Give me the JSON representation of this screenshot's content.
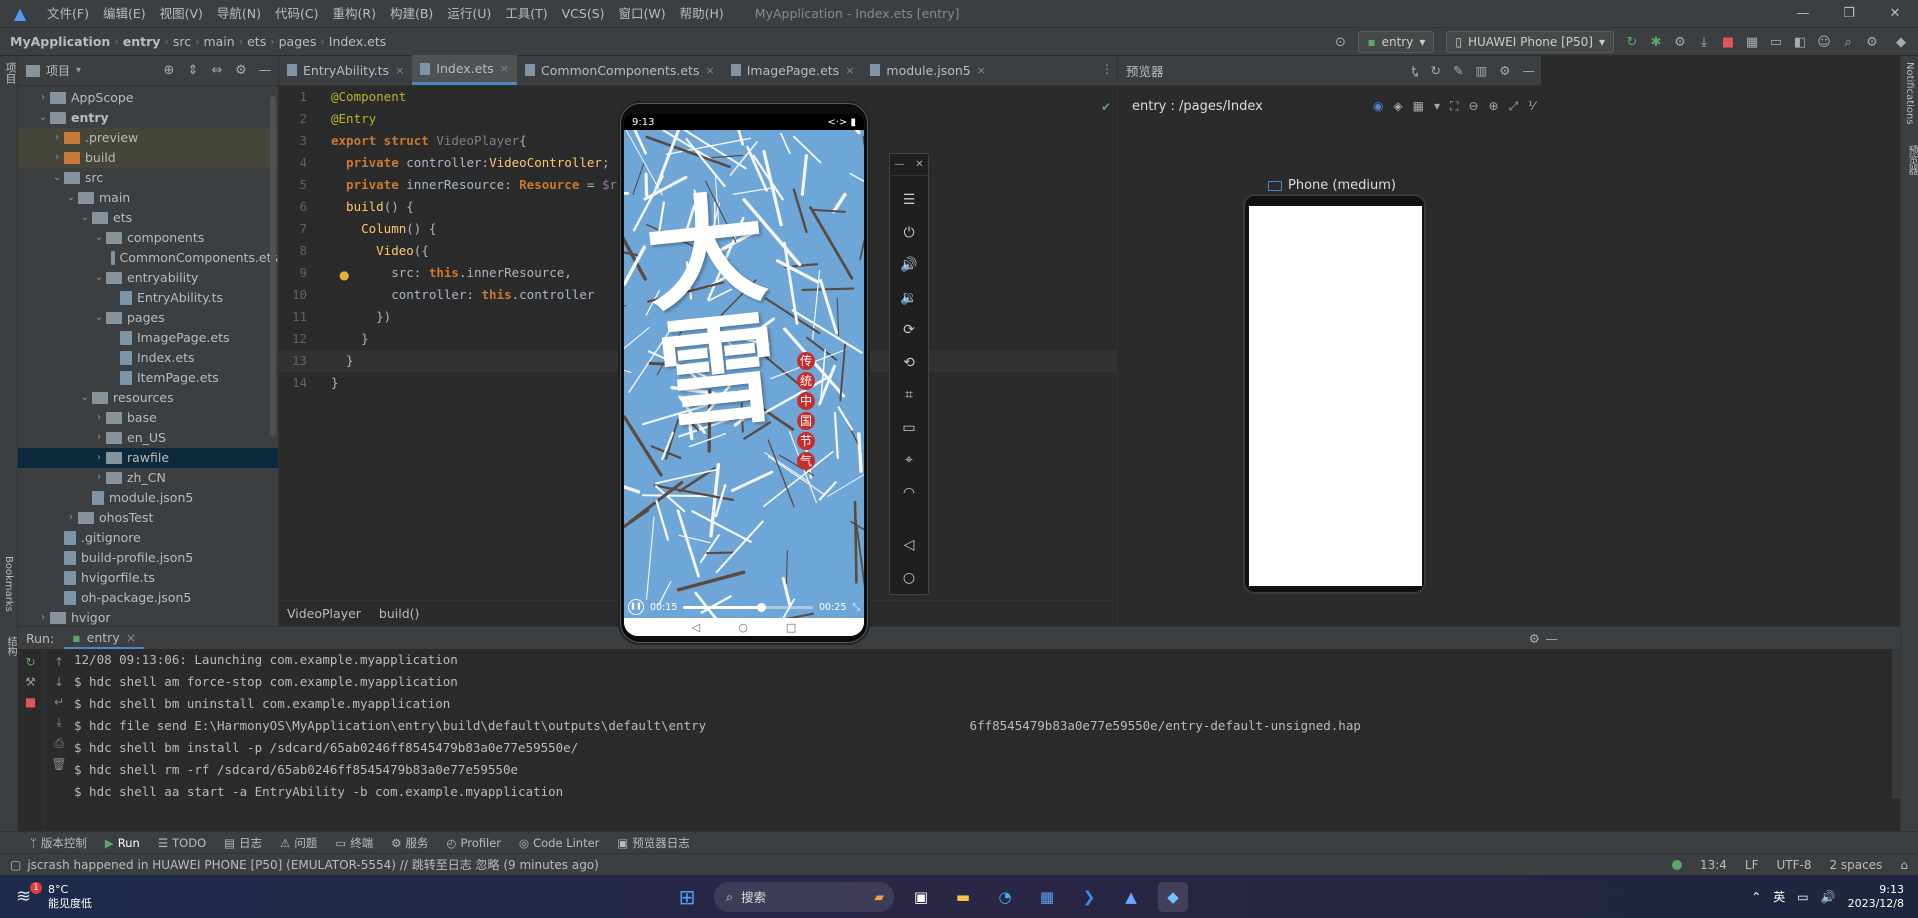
{
  "menubar": {
    "items": [
      "文件(F)",
      "编辑(E)",
      "视图(V)",
      "导航(N)",
      "代码(C)",
      "重构(R)",
      "构建(B)",
      "运行(U)",
      "工具(T)",
      "VCS(S)",
      "窗口(W)",
      "帮助(H)"
    ],
    "window_title": "MyApplication - Index.ets [entry]"
  },
  "navbar": {
    "crumbs": [
      "MyApplication",
      "entry",
      "src",
      "main",
      "ets",
      "pages",
      "Index.ets"
    ],
    "run_config": "entry",
    "device": "HUAWEI Phone [P50]"
  },
  "left_strip": {
    "project_label": "项目"
  },
  "project": {
    "title": "项目",
    "tree": [
      {
        "label": "AppScope",
        "depth": 1,
        "kind": "folder",
        "arrow": "›"
      },
      {
        "label": "entry",
        "depth": 1,
        "kind": "folder",
        "arrow": "⌄",
        "bold": true
      },
      {
        "label": ".preview",
        "depth": 2,
        "kind": "folder-orange",
        "arrow": "›"
      },
      {
        "label": "build",
        "depth": 2,
        "kind": "folder-orange",
        "arrow": "›"
      },
      {
        "label": "src",
        "depth": 2,
        "kind": "folder",
        "arrow": "⌄"
      },
      {
        "label": "main",
        "depth": 3,
        "kind": "folder",
        "arrow": "⌄"
      },
      {
        "label": "ets",
        "depth": 4,
        "kind": "folder",
        "arrow": "⌄"
      },
      {
        "label": "components",
        "depth": 5,
        "kind": "folder",
        "arrow": "⌄"
      },
      {
        "label": "CommonComponents.ets",
        "depth": 6,
        "kind": "file",
        "arrow": ""
      },
      {
        "label": "entryability",
        "depth": 5,
        "kind": "folder",
        "arrow": "⌄"
      },
      {
        "label": "EntryAbility.ts",
        "depth": 6,
        "kind": "file",
        "arrow": ""
      },
      {
        "label": "pages",
        "depth": 5,
        "kind": "folder",
        "arrow": "⌄"
      },
      {
        "label": "ImagePage.ets",
        "depth": 6,
        "kind": "file",
        "arrow": ""
      },
      {
        "label": "Index.ets",
        "depth": 6,
        "kind": "file",
        "arrow": ""
      },
      {
        "label": "ItemPage.ets",
        "depth": 6,
        "kind": "file",
        "arrow": ""
      },
      {
        "label": "resources",
        "depth": 4,
        "kind": "folder",
        "arrow": "⌄"
      },
      {
        "label": "base",
        "depth": 5,
        "kind": "folder",
        "arrow": "›"
      },
      {
        "label": "en_US",
        "depth": 5,
        "kind": "folder",
        "arrow": "›"
      },
      {
        "label": "rawfile",
        "depth": 5,
        "kind": "folder",
        "arrow": "›",
        "selected": true
      },
      {
        "label": "zh_CN",
        "depth": 5,
        "kind": "folder",
        "arrow": "›"
      },
      {
        "label": "module.json5",
        "depth": 4,
        "kind": "file",
        "arrow": ""
      },
      {
        "label": "ohosTest",
        "depth": 3,
        "kind": "folder",
        "arrow": "›"
      },
      {
        "label": ".gitignore",
        "depth": 2,
        "kind": "file",
        "arrow": ""
      },
      {
        "label": "build-profile.json5",
        "depth": 2,
        "kind": "file",
        "arrow": ""
      },
      {
        "label": "hvigorfile.ts",
        "depth": 2,
        "kind": "file",
        "arrow": ""
      },
      {
        "label": "oh-package.json5",
        "depth": 2,
        "kind": "file",
        "arrow": ""
      },
      {
        "label": "hvigor",
        "depth": 1,
        "kind": "folder",
        "arrow": "›"
      }
    ]
  },
  "editor": {
    "tabs": [
      {
        "label": "EntryAbility.ts",
        "active": false
      },
      {
        "label": "Index.ets",
        "active": true
      },
      {
        "label": "CommonComponents.ets",
        "active": false
      },
      {
        "label": "ImagePage.ets",
        "active": false
      },
      {
        "label": "module.json5",
        "active": false
      }
    ],
    "lines": [
      [
        {
          "t": "@Component",
          "c": "an"
        }
      ],
      [
        {
          "t": "@Entry",
          "c": "an"
        }
      ],
      [
        {
          "t": "export struct ",
          "c": "kw"
        },
        {
          "t": "VideoPlayer",
          "c": "gr"
        },
        {
          "t": "{",
          "c": "pl"
        }
      ],
      [
        {
          "t": "  private ",
          "c": "kw"
        },
        {
          "t": "controller:",
          "c": "pl"
        },
        {
          "t": "VideoController",
          "c": "ty2"
        },
        {
          "t": ";",
          "c": "pl"
        }
      ],
      [
        {
          "t": "  private ",
          "c": "kw"
        },
        {
          "t": "innerResource: ",
          "c": "pl"
        },
        {
          "t": "Resource",
          "c": "kw"
        },
        {
          "t": " = ",
          "c": "pl"
        },
        {
          "t": "$rawfile",
          "c": "ts"
        }
      ],
      [
        {
          "t": "  build",
          "c": "fn"
        },
        {
          "t": "() {",
          "c": "pl"
        }
      ],
      [
        {
          "t": "    Column",
          "c": "fn"
        },
        {
          "t": "() {",
          "c": "pl"
        }
      ],
      [
        {
          "t": "      Video",
          "c": "fn"
        },
        {
          "t": "({",
          "c": "pl"
        }
      ],
      [
        {
          "t": "        src: ",
          "c": "pl"
        },
        {
          "t": "this",
          "c": "kw"
        },
        {
          "t": ".innerResource,",
          "c": "pl"
        }
      ],
      [
        {
          "t": "        controller: ",
          "c": "pl"
        },
        {
          "t": "this",
          "c": "kw"
        },
        {
          "t": ".controller",
          "c": "pl"
        }
      ],
      [
        {
          "t": "      })",
          "c": "pl"
        }
      ],
      [
        {
          "t": "    }",
          "c": "pl"
        }
      ],
      [
        {
          "t": "  }",
          "c": "pl"
        }
      ],
      [
        {
          "t": "}",
          "c": "pl"
        }
      ]
    ],
    "current_line": 13,
    "breadcrumb": [
      "VideoPlayer",
      "build()"
    ]
  },
  "preview": {
    "title": "预览器",
    "path": "entry : /pages/Index",
    "device_label": "Phone (medium)"
  },
  "right_strip": {
    "notifications": "Notifications",
    "previewer": "预览器"
  },
  "emulator": {
    "time": "9:13",
    "status_right": "<·> ▮",
    "video_title": "大雪",
    "seal_chars": [
      "传",
      "统",
      "中",
      "国",
      "节",
      "气"
    ],
    "elapsed": "00:15",
    "total": "00:25",
    "progress": 0.6
  },
  "run": {
    "label": "Run:",
    "config": "entry",
    "lines": [
      "12/08 09:13:06: Launching com.example.myapplication",
      "$ hdc shell am force-stop com.example.myapplication",
      "$ hdc shell bm uninstall com.example.myapplication",
      "$ hdc file send E:\\HarmonyOS\\MyApplication\\entry\\build\\default\\outputs\\default\\entry                                   6ff8545479b83a0e77e59550e/entry-default-unsigned.hap",
      "$ hdc shell bm install -p /sdcard/65ab0246ff8545479b83a0e77e59550e/",
      "$ hdc shell rm -rf /sdcard/65ab0246ff8545479b83a0e77e59550e",
      "$ hdc shell aa start -a EntryAbility -b com.example.myapplication"
    ]
  },
  "bottom_tabs": [
    "版本控制",
    "Run",
    "TODO",
    "日志",
    "问题",
    "终端",
    "服务",
    "Profiler",
    "Code Linter",
    "预览器日志"
  ],
  "status": {
    "message": "jscrash happened in HUAWEI PHONE [P50] (EMULATOR-5554) // 跳转至日志   忽略 (9 minutes ago)",
    "position": "13:4",
    "line_sep": "LF",
    "encoding": "UTF-8",
    "indent": "2 spaces"
  },
  "taskbar": {
    "temp": "8°C",
    "weather": "能见度低",
    "badge": "1",
    "search": "搜索",
    "ime": "英",
    "time": "9:13",
    "date": "2023/12/8"
  }
}
